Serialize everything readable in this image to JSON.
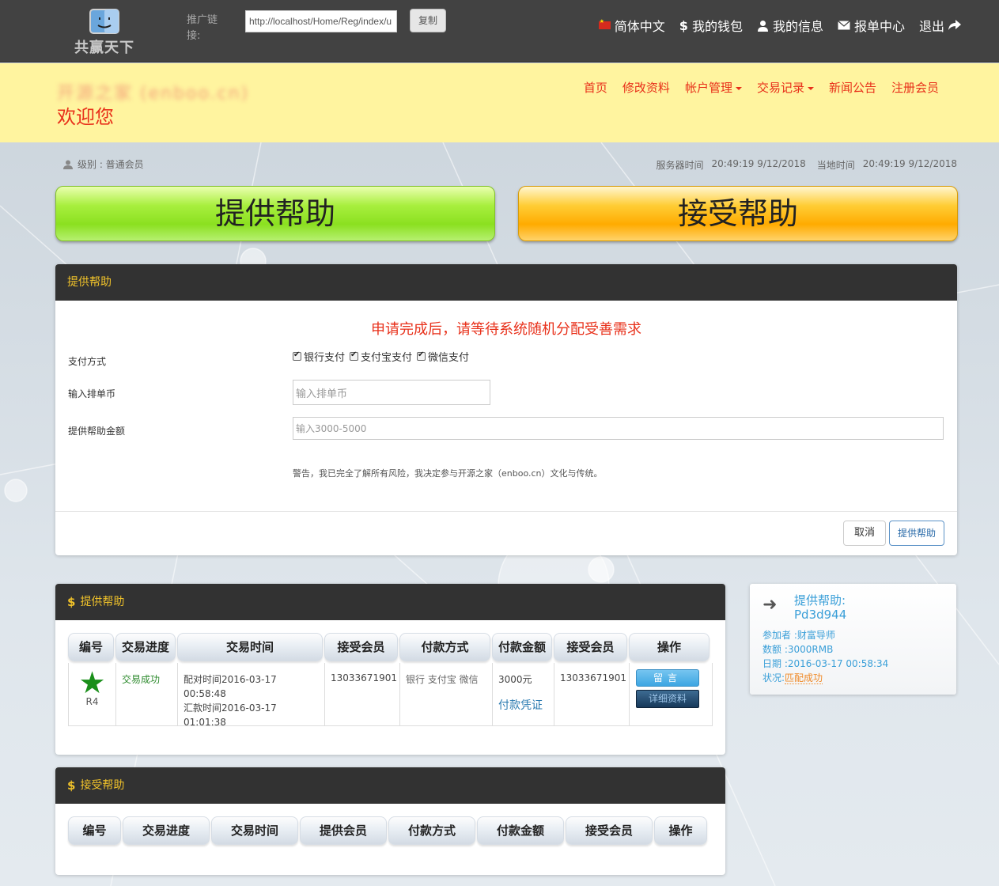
{
  "topbar": {
    "logo_text": "共赢天下",
    "logo_icon": "finder-face-icon",
    "promo_label": "推广链接:",
    "promo_url": "http://localhost/Home/Reg/index/u",
    "copy_label": "复制",
    "language": "简体中文",
    "wallet": "我的钱包",
    "my_info": "我的信息",
    "report_center": "报单中心",
    "logout": "退出"
  },
  "header": {
    "site_name": "开源之家 (enboo.cn)",
    "welcome": "欢迎您",
    "nav": [
      "首页",
      "修改资料",
      "帐户管理",
      "交易记录",
      "新闻公告",
      "注册会员"
    ]
  },
  "info": {
    "level": "级别 : 普通会员",
    "server_time_label": "服务器时间",
    "server_time": "20:49:19 9/12/2018",
    "local_time_label": "当地时间",
    "local_time": "20:49:19 9/12/2018"
  },
  "big_buttons": {
    "provide": "提供帮助",
    "accept": "接受帮助"
  },
  "form": {
    "title": "提供帮助",
    "notice": "申请完成后，请等待系统随机分配受善需求",
    "payment_label": "支付方式",
    "payment_options": [
      "银行支付",
      "支付宝支付",
      "微信支付"
    ],
    "coin_label": "输入排单币",
    "coin_placeholder": "输入排单币",
    "amount_label": "提供帮助金额",
    "amount_placeholder": "输入3000-5000",
    "warning": "警告，我已完全了解所有风险，我决定参与开源之家（enboo.cn）文化与传统。",
    "cancel": "取消",
    "submit": "提供帮助"
  },
  "provide_table": {
    "title": "提供帮助",
    "headers": [
      "编号",
      "交易进度",
      "交易时间",
      "接受会员",
      "付款方式",
      "付款金额",
      "接受会员",
      "操作"
    ],
    "row": {
      "rank": "R4",
      "status": "交易成功",
      "match_time": "配对时间2016-03-17 00:58:48",
      "remit_time": "汇款时间2016-03-17 01:01:38",
      "receiver": "13033671901",
      "payment": "银行 支付宝 微信",
      "amount": "3000元",
      "voucher": "付款凭证",
      "receiver2": "13033671901",
      "msg_btn": "留言",
      "detail_btn": "详细资料"
    }
  },
  "accept_table": {
    "title": "接受帮助",
    "headers": [
      "编号",
      "交易进度",
      "交易时间",
      "提供会员",
      "付款方式",
      "付款金额",
      "接受会员",
      "操作"
    ]
  },
  "side_card": {
    "title": "提供帮助:",
    "code": "Pd3d944",
    "participant": "参加者 :财富导师",
    "amount": "数额 :3000RMB",
    "date": "日期 :2016-03-17 00:58:34",
    "status_label": "状况:",
    "status": "匹配成功"
  }
}
